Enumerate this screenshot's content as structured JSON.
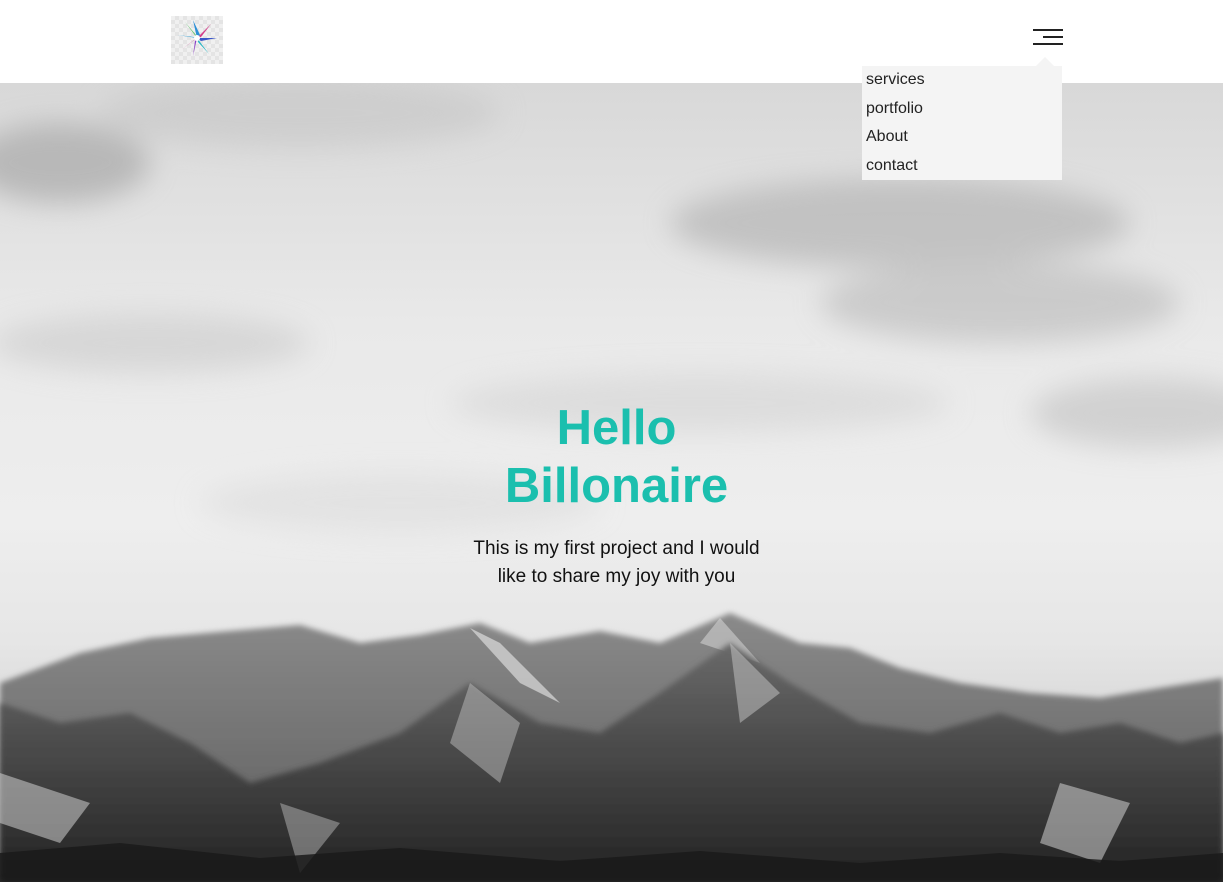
{
  "header": {
    "logo_icon": "colorful-star-logo",
    "menu_icon": "hamburger-menu-icon"
  },
  "nav": {
    "items": [
      {
        "label": "services"
      },
      {
        "label": "portfolio"
      },
      {
        "label": "About"
      },
      {
        "label": "contact"
      }
    ]
  },
  "hero": {
    "title_line1": "Hello",
    "title_line2": "Billonaire",
    "subtitle_line1": "This is my first project and I would",
    "subtitle_line2": "like to share my joy with you",
    "background": "grayscale-mountain-landscape"
  },
  "colors": {
    "accent": "#1bbfae",
    "dropdown_bg": "#f4f4f4",
    "header_bg": "#ffffff"
  }
}
